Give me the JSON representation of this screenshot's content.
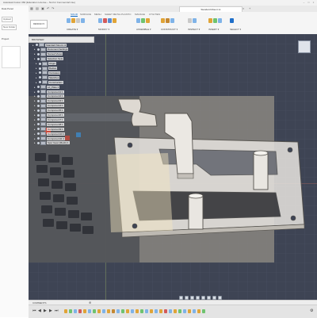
{
  "app": {
    "title": "Autodesk Fusion 360 (Education License – Not for Commercial Use)"
  },
  "data_panel": {
    "rows": [
      "Data Panel",
      "Upload",
      "Project"
    ],
    "button_labels": [
      "Upload",
      "New Folder"
    ]
  },
  "document_tab": {
    "name": "Standard Mount v1"
  },
  "toolbar": {
    "workspace_tabs": [
      "SOLID",
      "SURFACE",
      "MESH",
      "SHEET METAL",
      "PLASTIC",
      "MANAGE",
      "UTILITIES"
    ],
    "active_tab": "SOLID",
    "design_button": "DESIGN ▾",
    "groups": [
      {
        "label": "CREATE ▾",
        "colors": [
          "#7fb3e8",
          "#e0a437",
          "#c9c9c9",
          "#7fb3e8"
        ]
      },
      {
        "label": "MODIFY ▾",
        "colors": [
          "#7fb3e8",
          "#d35a5a",
          "#5a8ed3",
          "#e0a437"
        ]
      },
      {
        "label": "ASSEMBLE ▾",
        "colors": [
          "#7fb3e8",
          "#6fc36f",
          "#e0a437"
        ]
      },
      {
        "label": "CONSTRUCT ▾",
        "colors": [
          "#e0a437",
          "#c48833",
          "#7fb3e8"
        ]
      },
      {
        "label": "INSPECT ▾",
        "colors": [
          "#c9c9c9",
          "#7fb3e8"
        ]
      },
      {
        "label": "INSERT ▾",
        "colors": [
          "#e0a437",
          "#6fc36f",
          "#7fb3e8"
        ]
      },
      {
        "label": "SELECT ▾",
        "colors": [
          "#1f6fc9"
        ]
      }
    ]
  },
  "browser": {
    "header": "BROWSER",
    "items": [
      "Standard Mount v1",
      "Document Settings",
      "Named Views",
      "Selection Sets",
      "Origin",
      "Bodies",
      "Canvases",
      "Sketches",
      "Construction",
      "Ld_Plate:1",
      "Component1:1",
      "Component2:1",
      "Component3:1",
      "Component4:1",
      "Component5:1",
      "Component6:1",
      "Component7:1",
      "Component8:1",
      "Component9:1",
      "Component10:1",
      "Component11:1",
      "Spur Gear (Mesh):1"
    ]
  },
  "bottom": {
    "comments_label": "COMMENTS",
    "timeline_playback": [
      "⏮",
      "◀",
      "▶",
      "▶",
      "⏭"
    ]
  },
  "colors": {
    "canvas": "#3e4454",
    "selection_blue": "#1f6fc9",
    "plate": "#e4e1dc"
  }
}
